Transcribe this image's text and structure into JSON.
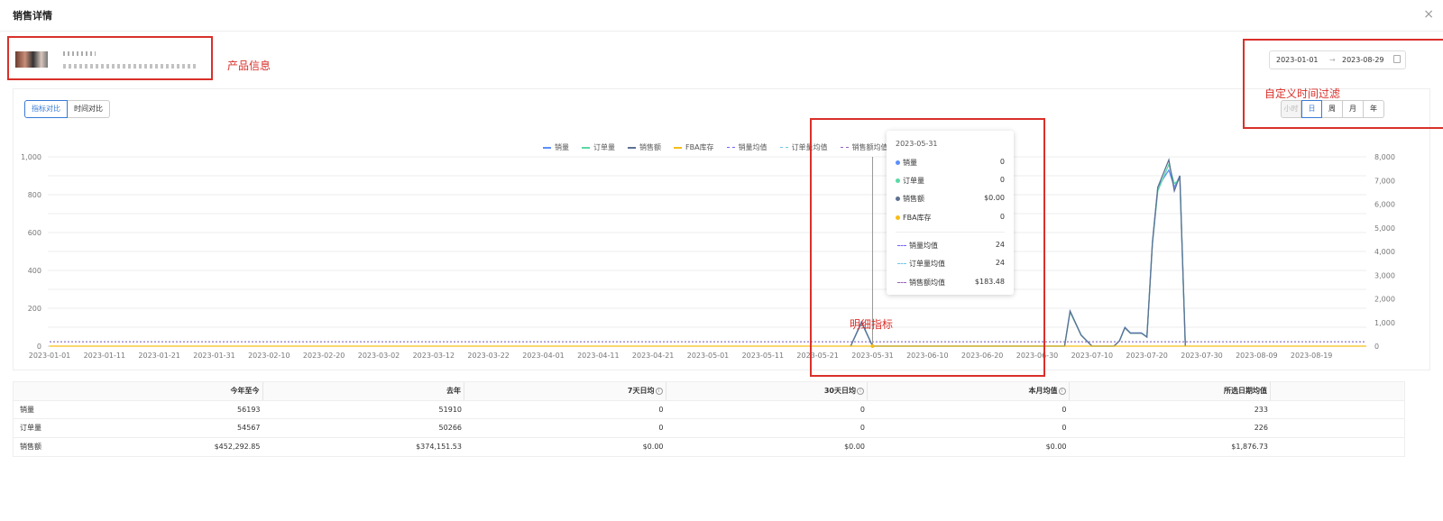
{
  "modal": {
    "title": "销售详情",
    "close_icon": "×"
  },
  "annotations": {
    "product_info": "产品信息",
    "custom_time_filter": "自定义时间过滤",
    "detail_metrics": "明细指标"
  },
  "date_range": {
    "start": "2023-01-01",
    "arrow": "→",
    "end": "2023-08-29",
    "calendar_icon": "calendar-icon"
  },
  "compare_tabs": [
    {
      "label": "指标对比",
      "active": true
    },
    {
      "label": "时间对比",
      "active": false
    }
  ],
  "granularity": [
    {
      "label": "小时",
      "active": false,
      "disabled": true
    },
    {
      "label": "日",
      "active": true
    },
    {
      "label": "周",
      "active": false
    },
    {
      "label": "月",
      "active": false
    },
    {
      "label": "年",
      "active": false
    }
  ],
  "chart_data": {
    "type": "line",
    "legend_position": "top",
    "grid": true,
    "x_ticks": [
      "2023-01-01",
      "2023-01-11",
      "2023-01-21",
      "2023-01-31",
      "2023-02-10",
      "2023-02-20",
      "2023-03-02",
      "2023-03-12",
      "2023-03-22",
      "2023-04-01",
      "2023-04-11",
      "2023-04-21",
      "2023-05-01",
      "2023-05-11",
      "2023-05-21",
      "2023-05-31",
      "2023-06-10",
      "2023-06-20",
      "2023-06-30",
      "2023-07-10",
      "2023-07-20",
      "2023-07-30",
      "2023-08-09",
      "2023-08-19"
    ],
    "y_left": {
      "ticks": [
        "0",
        "200",
        "400",
        "600",
        "800",
        "1,000"
      ],
      "range": [
        0,
        1000
      ]
    },
    "y_right": {
      "ticks": [
        "0",
        "1,000",
        "2,000",
        "3,000",
        "4,000",
        "5,000",
        "6,000",
        "7,000",
        "8,000"
      ],
      "range": [
        0,
        8000
      ]
    },
    "series": [
      {
        "name": "销量",
        "color": "#5b8ff9",
        "style": "solid",
        "points": [
          [
            "2023-05-27",
            0
          ],
          [
            "2023-05-29",
            130
          ],
          [
            "2023-05-31",
            0
          ],
          [
            "2023-07-05",
            0
          ],
          [
            "2023-07-06",
            185
          ],
          [
            "2023-07-08",
            60
          ],
          [
            "2023-07-10",
            0
          ],
          [
            "2023-07-14",
            0
          ],
          [
            "2023-07-15",
            30
          ],
          [
            "2023-07-16",
            100
          ],
          [
            "2023-07-17",
            70
          ],
          [
            "2023-07-19",
            70
          ],
          [
            "2023-07-20",
            50
          ],
          [
            "2023-07-21",
            550
          ],
          [
            "2023-07-22",
            840
          ],
          [
            "2023-07-24",
            930
          ],
          [
            "2023-07-25",
            840
          ],
          [
            "2023-07-26",
            900
          ],
          [
            "2023-07-27",
            0
          ]
        ]
      },
      {
        "name": "订单量",
        "color": "#5ad8a6",
        "style": "solid",
        "points": [
          [
            "2023-05-27",
            0
          ],
          [
            "2023-05-29",
            125
          ],
          [
            "2023-05-31",
            0
          ],
          [
            "2023-07-05",
            0
          ],
          [
            "2023-07-06",
            180
          ],
          [
            "2023-07-08",
            58
          ],
          [
            "2023-07-10",
            0
          ],
          [
            "2023-07-14",
            0
          ],
          [
            "2023-07-15",
            28
          ],
          [
            "2023-07-16",
            96
          ],
          [
            "2023-07-17",
            68
          ],
          [
            "2023-07-19",
            68
          ],
          [
            "2023-07-20",
            48
          ],
          [
            "2023-07-21",
            540
          ],
          [
            "2023-07-22",
            820
          ],
          [
            "2023-07-24",
            960
          ],
          [
            "2023-07-25",
            860
          ],
          [
            "2023-07-26",
            880
          ],
          [
            "2023-07-27",
            0
          ]
        ]
      },
      {
        "name": "销售额",
        "color": "#5d7092",
        "style": "solid",
        "axis": "right",
        "points": [
          [
            "2023-05-27",
            0
          ],
          [
            "2023-05-29",
            1000
          ],
          [
            "2023-05-31",
            0
          ],
          [
            "2023-07-05",
            0
          ],
          [
            "2023-07-06",
            1480
          ],
          [
            "2023-07-08",
            460
          ],
          [
            "2023-07-10",
            0
          ],
          [
            "2023-07-14",
            0
          ],
          [
            "2023-07-15",
            220
          ],
          [
            "2023-07-16",
            780
          ],
          [
            "2023-07-17",
            550
          ],
          [
            "2023-07-19",
            550
          ],
          [
            "2023-07-20",
            380
          ],
          [
            "2023-07-21",
            4350
          ],
          [
            "2023-07-22",
            6720
          ],
          [
            "2023-07-24",
            7870
          ],
          [
            "2023-07-25",
            6560
          ],
          [
            "2023-07-26",
            7200
          ],
          [
            "2023-07-27",
            0
          ]
        ]
      },
      {
        "name": "FBA库存",
        "color": "#f6bd16",
        "style": "solid",
        "points": [
          [
            "2023-01-01",
            0
          ],
          [
            "2023-08-29",
            0
          ]
        ]
      },
      {
        "name": "销量均值",
        "color": "#7262fd",
        "style": "dashed",
        "points": [
          [
            "2023-01-01",
            24
          ],
          [
            "2023-08-29",
            24
          ]
        ]
      },
      {
        "name": "订单量均值",
        "color": "#6dc8ec",
        "style": "dashed",
        "points": [
          [
            "2023-01-01",
            24
          ],
          [
            "2023-08-29",
            24
          ]
        ]
      },
      {
        "name": "销售额均值",
        "color": "#9661bc",
        "style": "dashed",
        "axis": "right",
        "points": [
          [
            "2023-01-01",
            183.48
          ],
          [
            "2023-08-29",
            183.48
          ]
        ]
      }
    ],
    "crosshair_x": "2023-05-31"
  },
  "tooltip": {
    "date": "2023-05-31",
    "rows": [
      {
        "label": "销量",
        "value": "0",
        "color": "#5b8ff9",
        "kind": "dot"
      },
      {
        "label": "订单量",
        "value": "0",
        "color": "#5ad8a6",
        "kind": "dot"
      },
      {
        "label": "销售额",
        "value": "$0.00",
        "color": "#5d7092",
        "kind": "dot"
      },
      {
        "label": "FBA库存",
        "value": "0",
        "color": "#f6bd16",
        "kind": "dot"
      },
      {
        "label": "销量均值",
        "value": "24",
        "color": "#7262fd",
        "kind": "dash"
      },
      {
        "label": "订单量均值",
        "value": "24",
        "color": "#6dc8ec",
        "kind": "dash"
      },
      {
        "label": "销售额均值",
        "value": "$183.48",
        "color": "#9661bc",
        "kind": "dash"
      }
    ]
  },
  "table": {
    "headers": [
      "",
      "今年至今",
      "去年",
      "7天日均",
      "30天日均",
      "本月均值",
      "所选日期均值"
    ],
    "info_icon_cols": [
      3,
      4,
      5
    ],
    "rows": [
      [
        "销量",
        "56193",
        "51910",
        "0",
        "0",
        "0",
        "233"
      ],
      [
        "订单量",
        "54567",
        "50266",
        "0",
        "0",
        "0",
        "226"
      ],
      [
        "销售额",
        "$452,292.85",
        "$374,151.53",
        "$0.00",
        "$0.00",
        "$0.00",
        "$1,876.73"
      ]
    ]
  }
}
